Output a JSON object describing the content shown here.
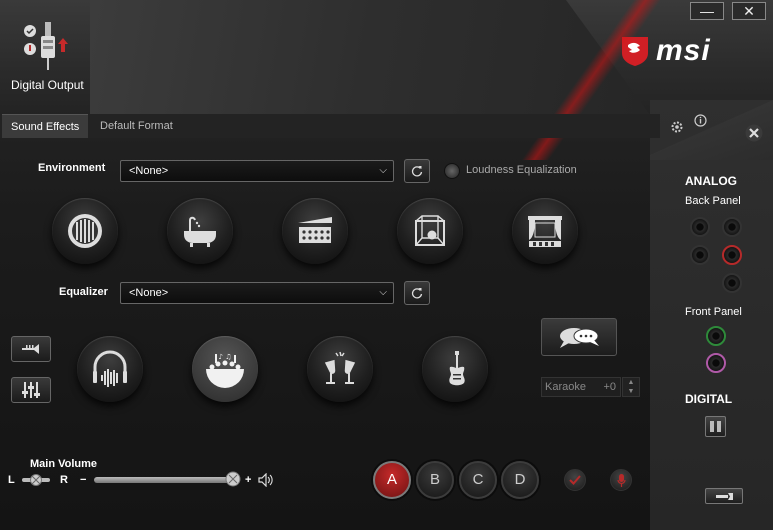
{
  "window": {
    "minimize_label": "—",
    "close_label": "✕"
  },
  "header": {
    "device_label": "Digital Output",
    "brand": "msi"
  },
  "tabs": [
    {
      "label": "Sound Effects",
      "active": true
    },
    {
      "label": "Default Format",
      "active": false
    }
  ],
  "environment": {
    "label": "Environment",
    "selected": "<None>",
    "loudness_label": "Loudness Equalization",
    "presets": [
      "room-icon",
      "bathroom-icon",
      "concert-hall-icon",
      "stone-room-icon",
      "theater-icon"
    ]
  },
  "equalizer": {
    "label": "Equalizer",
    "selected": "<None>",
    "presets": [
      "headphone-bass-icon",
      "live-crowd-icon",
      "party-icon",
      "guitar-icon"
    ]
  },
  "karaoke": {
    "label": "Karaoke",
    "value": "+0"
  },
  "profiles": [
    "A",
    "B",
    "C",
    "D"
  ],
  "volume": {
    "label": "Main Volume",
    "left": "L",
    "right": "R",
    "minus": "−",
    "plus": "+",
    "level": 0.95
  },
  "analog": {
    "title": "ANALOG",
    "back_panel": "Back Panel",
    "front_panel": "Front Panel"
  },
  "digital": {
    "title": "DIGITAL"
  },
  "colors": {
    "accent_red": "#c52a2a",
    "jack_green": "#2e8a3a",
    "jack_pink": "#b05aa8"
  }
}
